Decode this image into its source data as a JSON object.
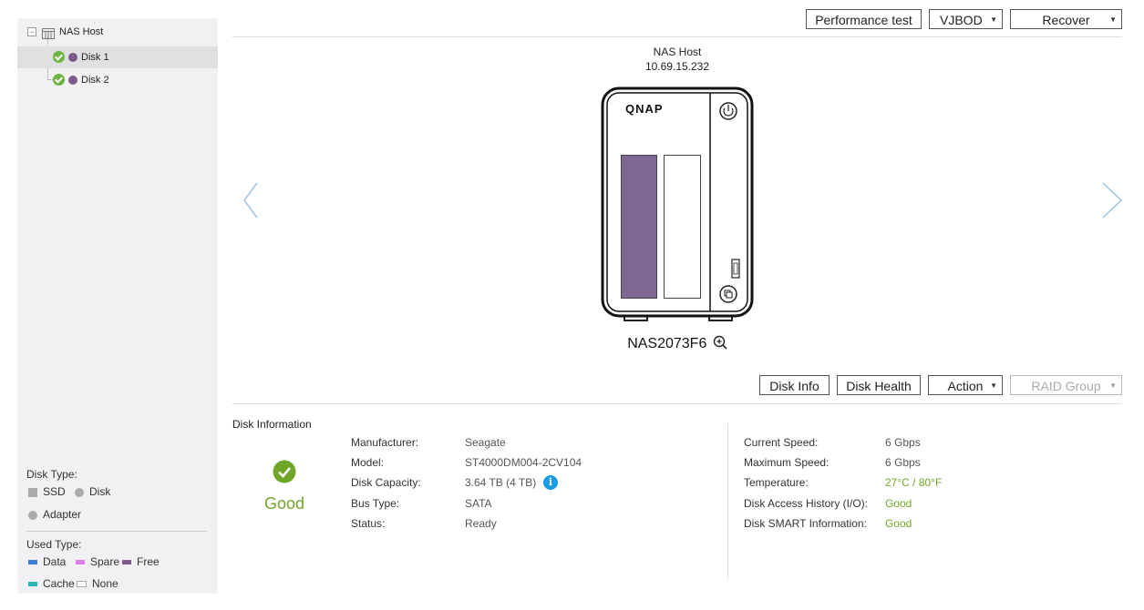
{
  "sidebar": {
    "tree": {
      "root_label": "NAS Host",
      "items": [
        {
          "label": "Disk 1",
          "selected": true
        },
        {
          "label": "Disk 2",
          "selected": false
        }
      ]
    },
    "disk_type": {
      "title": "Disk Type:",
      "items": [
        "SSD",
        "Disk",
        "Adapter"
      ]
    },
    "used_type": {
      "title": "Used Type:",
      "items": [
        {
          "label": "Data",
          "color": "#3b7ddd"
        },
        {
          "label": "Spare",
          "color": "#d97ee6"
        },
        {
          "label": "Free",
          "color": "#7c5a8a"
        },
        {
          "label": "Cache",
          "color": "#2bb6b6"
        },
        {
          "label": "None",
          "color": "#ffffff"
        }
      ]
    }
  },
  "toolbar_top": {
    "performance_test": "Performance test",
    "vjbod": "VJBOD",
    "recover": "Recover"
  },
  "device": {
    "host_name": "NAS Host",
    "ip": "10.69.15.232",
    "brand": "QNAP",
    "model": "NAS2073F6",
    "slot_colors": [
      "#7f6793",
      "#ffffff"
    ]
  },
  "toolbar_bottom": {
    "disk_info": "Disk Info",
    "disk_health": "Disk Health",
    "action": "Action",
    "raid_group": "RAID Group"
  },
  "disk_information": {
    "heading": "Disk Information",
    "status_summary": "Good",
    "left": [
      {
        "label": "Manufacturer:",
        "value": "Seagate"
      },
      {
        "label": "Model:",
        "value": "ST4000DM004-2CV104"
      },
      {
        "label": "Disk Capacity:",
        "value": "3.64 TB (4 TB)"
      },
      {
        "label": "Bus Type:",
        "value": "SATA"
      },
      {
        "label": "Status:",
        "value": "Ready"
      }
    ],
    "right": [
      {
        "label": "Current Speed:",
        "value": "6 Gbps"
      },
      {
        "label": "Maximum Speed:",
        "value": "6 Gbps"
      },
      {
        "label": "Temperature:",
        "value": "27°C / 80°F"
      },
      {
        "label": "Disk Access History (I/O):",
        "value": "Good"
      },
      {
        "label": "Disk SMART Information:",
        "value": "Good"
      }
    ]
  },
  "colors": {
    "good": "#6fa628",
    "info_icon": "#1a9be8",
    "nav_arrow": "#9cc4e4"
  }
}
